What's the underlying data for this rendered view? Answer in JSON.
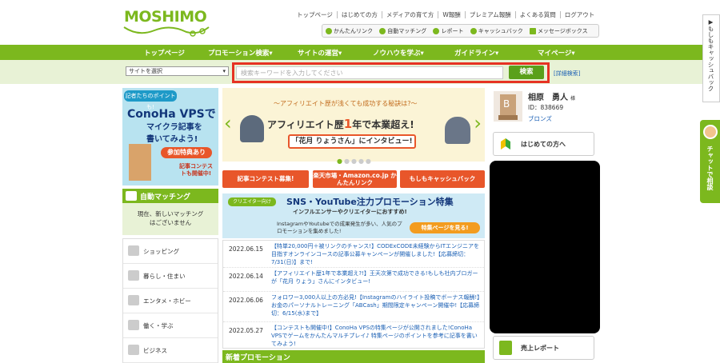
{
  "logo": {
    "text": "MOSHIMO"
  },
  "top_links": [
    "トップページ",
    "はじめての方",
    "メディアの育て方",
    "W報酬",
    "プレミアム報酬",
    "よくある質問",
    "ログアウト"
  ],
  "quickbar": [
    "かんたんリンク",
    "自動マッチング",
    "レポート",
    "キャッシュバック",
    "メッセージボックス"
  ],
  "nav": [
    "トップページ",
    "プロモーション検索",
    "サイトの運営",
    "ノウハウを学ぶ",
    "ガイドライン",
    "マイページ"
  ],
  "search": {
    "select_value": "サイトを選択",
    "placeholder": "検索キーワードを入力してください",
    "button": "検索",
    "detail_link": "[詳細検索]"
  },
  "side_tab": "もしもキャッシュバック",
  "chat_tab": "チャットで相談",
  "conoha_banner": {
    "ribbon": "記者たちのポイントも!",
    "title": "ConoHa VPSで",
    "line2": "マイクラ記事を",
    "line3": "書いてみよう!",
    "badge": "参加特典あり",
    "note": "記事コンテストも開催中!"
  },
  "automatch": {
    "title": "自動マッチング",
    "body": "現在、新しいマッチングはございません"
  },
  "categories": [
    "ショッピング",
    "暮らし・住まい",
    "エンタメ・ホビー",
    "働く・学ぶ",
    "ビジネス"
  ],
  "banner": {
    "sub": "〜アフィリエイト歴が浅くても成功する秘訣は?〜",
    "main_pre": "アフィリエイト歴",
    "main_num": "1",
    "main_post": "年で本業超え!",
    "sub2": "「花月 りょうさん」にインタビュー!"
  },
  "promo_buttons": [
    "記事コンテスト募集!",
    "楽天市場・Amazon.co.jp かんたんリンク",
    "もしもキャッシュバック"
  ],
  "sns": {
    "tag": "クリエイター向け",
    "title": "SNS・YouTube注力プロモーション特集",
    "sub": "インフルエンサーやクリエイターにおすすめ!",
    "small": "InstagramやYoutubeでの成果発生が多い、人気のプロモーションを集めました!",
    "button": "特集ページを見る!"
  },
  "news": [
    {
      "date": "2022.06.15",
      "text": "【特単20,000円＋被リンクのチャンス!】CODExCODE未経験からITエンジニアを目指すオンラインコースの記事公募キャンペーンが開催しました!【応募締切：7/31(日)】まで!"
    },
    {
      "date": "2022.06.14",
      "text": "【アフィリエイト歴1年で本業超え?!】王天次第で成功できる!もしも社内ブロガーが「花月 りょう」さんにインタビュー!"
    },
    {
      "date": "2022.06.06",
      "text": "フォロワー3,000人以上の方必見!【Instagramのハイライト投稿でボーナス報酬!】お金のパーソナルトレーニング「ABCash」期間限定キャンペーン開催中!【応募締切：6/15(水)まで】"
    },
    {
      "date": "2022.05.27",
      "text": "【コンテストも開催中!】ConoHa VPSの特集ページが公開されました!ConoHa VPSでゲームをかんたんマルチプレイ♪ 特集ページのポイントを参考に記事を書いてみよう!"
    }
  ],
  "new_promo_head": "新着プロモーション",
  "profile": {
    "name": "相原　勇人",
    "suffix": "様",
    "id": "ID：838669",
    "rank": "ブロンズ"
  },
  "buttons": {
    "hajime": "はじめての方へ",
    "report": "売上レポート"
  },
  "colors": {
    "brand_green": "#7cb81e",
    "accent_orange": "#e8562a",
    "highlight_red": "#e63223"
  }
}
